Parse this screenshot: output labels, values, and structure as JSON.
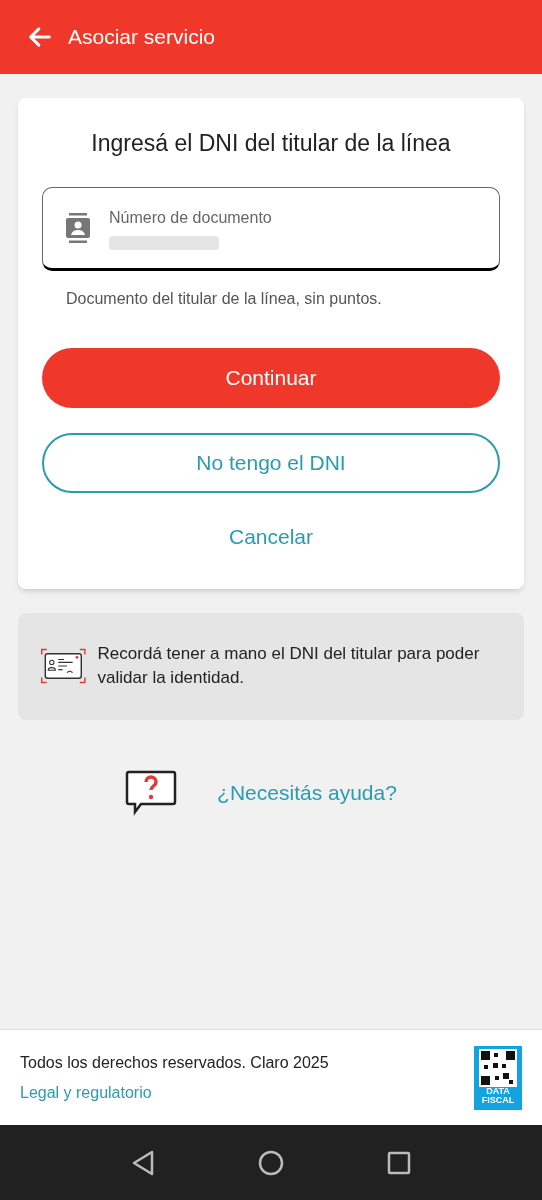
{
  "header": {
    "title": "Asociar servicio"
  },
  "card": {
    "title": "Ingresá el DNI del titular de la línea",
    "field": {
      "label": "Número de documento"
    },
    "helper": "Documento del titular de la línea, sin puntos.",
    "buttons": [
      {
        "label": "Continuar",
        "kind": "primary"
      },
      {
        "label": "No tengo el DNI",
        "kind": "outline"
      },
      {
        "label": "Cancelar",
        "kind": "text"
      }
    ]
  },
  "notice": {
    "text": "Recordá tener a mano el DNI del titular para poder validar la identidad."
  },
  "help": {
    "link": "¿Necesitás ayuda?"
  },
  "footer": {
    "copyright": "Todos los derechos reservados. Claro 2025",
    "link": "Legal y regulatorio",
    "badge": "DATA FISCAL"
  }
}
